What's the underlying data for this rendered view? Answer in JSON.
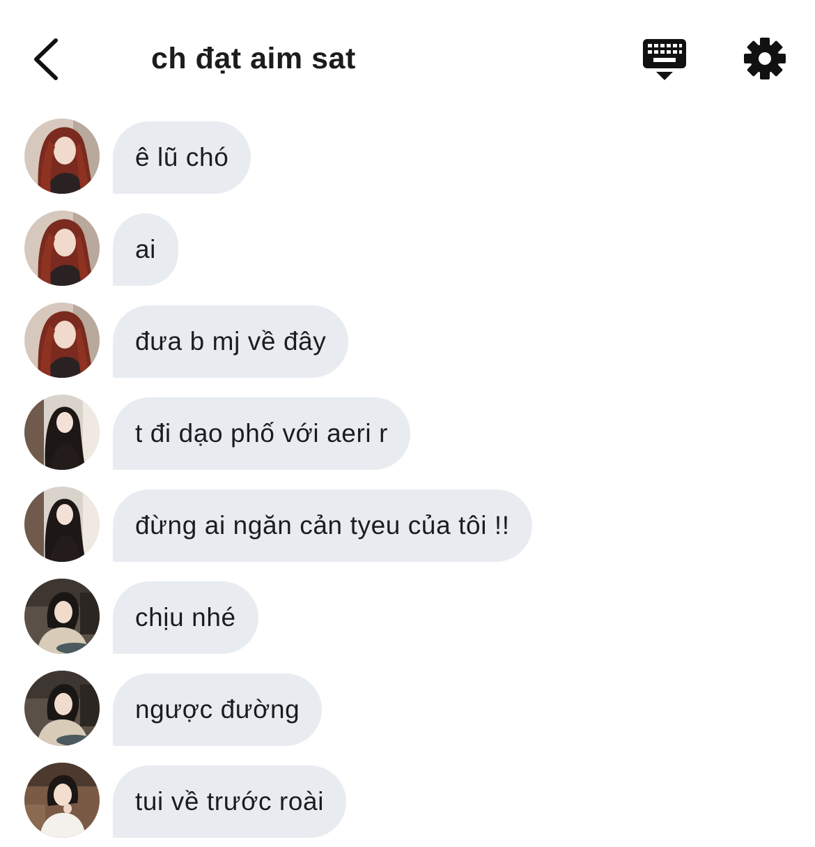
{
  "header": {
    "title": "ch đạt aim sat",
    "back_icon": "chevron-left-icon",
    "keyboard_icon": "keyboard-dismiss-icon",
    "settings_icon": "gear-icon"
  },
  "colors": {
    "bubble_bg": "#e8ecf1",
    "text": "#1c1c1e",
    "icon": "#111111"
  },
  "messages": [
    {
      "sender": "user-red-hair",
      "text": "ê lũ chó"
    },
    {
      "sender": "user-red-hair",
      "text": "ai"
    },
    {
      "sender": "user-red-hair",
      "text": "đưa b mj về đây"
    },
    {
      "sender": "user-dark-long-hair",
      "text": "t đi dạo phố với aeri r"
    },
    {
      "sender": "user-dark-long-hair",
      "text": "đừng ai ngăn cản tyeu của tôi !!"
    },
    {
      "sender": "user-sweater",
      "text": "chịu nhé"
    },
    {
      "sender": "user-sweater",
      "text": "ngược đường"
    },
    {
      "sender": "user-white-top",
      "text": "tui về trước roài"
    }
  ]
}
